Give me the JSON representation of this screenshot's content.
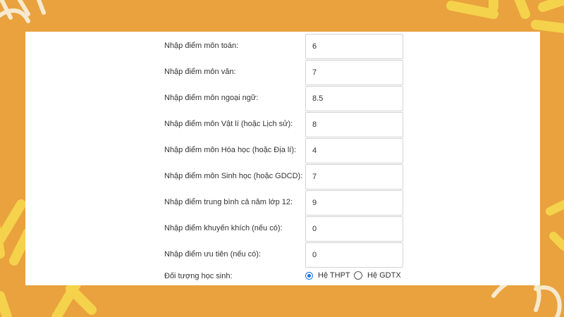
{
  "form": {
    "fields": [
      {
        "label": "Nhập điểm môn toán:",
        "value": "6"
      },
      {
        "label": "Nhập điểm môn văn:",
        "value": "7"
      },
      {
        "label": "Nhập điểm môn ngoại ngữ:",
        "value": "8.5"
      },
      {
        "label": "Nhập điểm môn Vật lí (hoặc Lịch sử):",
        "value": "8"
      },
      {
        "label": "Nhập điểm môn Hóa học (hoặc Địa lí):",
        "value": "4"
      },
      {
        "label": "Nhập điểm môn Sinh học (hoặc GDCD):",
        "value": "7"
      },
      {
        "label": "Nhập điểm trung bình cả năm lớp 12:",
        "value": "9"
      },
      {
        "label": "Nhập điểm khuyến khích (nếu có):",
        "value": "0"
      },
      {
        "label": "Nhập điểm ưu tiên (nếu có):",
        "value": "0"
      }
    ],
    "student_type": {
      "label": "Đối tượng học sinh:",
      "options": [
        {
          "label": "Hệ THPT",
          "checked": true
        },
        {
          "label": "Hệ GDTX",
          "checked": false
        }
      ]
    }
  },
  "colors": {
    "background": "#e9a23e",
    "decoration_yellow": "#f5d24b",
    "decoration_cream": "#f7e9cf",
    "radio_accent": "#1a73e8"
  }
}
